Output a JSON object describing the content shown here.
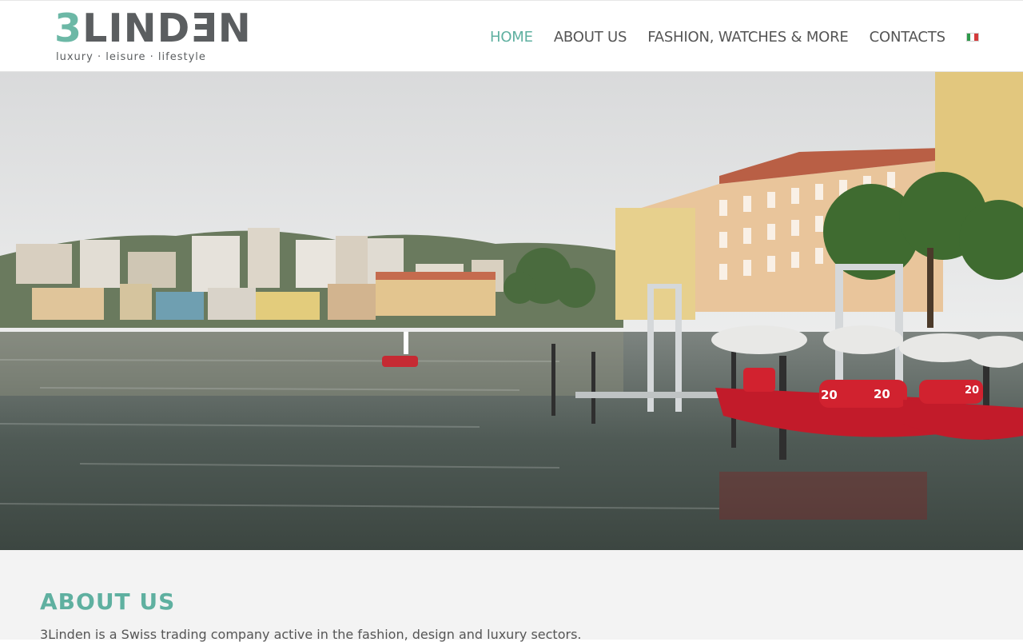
{
  "brand": {
    "logo_left": "3",
    "logo_mid": "LIND",
    "logo_e": "E",
    "logo_right": "N",
    "tagline": "luxury · leisure · lifestyle",
    "teal": "#6cb8a6",
    "gray": "#5b5e60"
  },
  "nav": {
    "items": [
      {
        "label": "HOME",
        "active": true
      },
      {
        "label": "ABOUT US",
        "active": false
      },
      {
        "label": "FASHION, WATCHES & MORE",
        "active": false
      },
      {
        "label": "CONTACTS",
        "active": false
      }
    ],
    "language_icon": "italian-flag-icon",
    "accent": "#5fb0a0"
  },
  "hero": {
    "image": "lakeside-town-photo",
    "boat_numbers": [
      "20",
      "20",
      "20"
    ]
  },
  "about": {
    "title": "ABOUT US",
    "text": "3Linden is a Swiss trading company active in the fashion, design and luxury sectors."
  }
}
